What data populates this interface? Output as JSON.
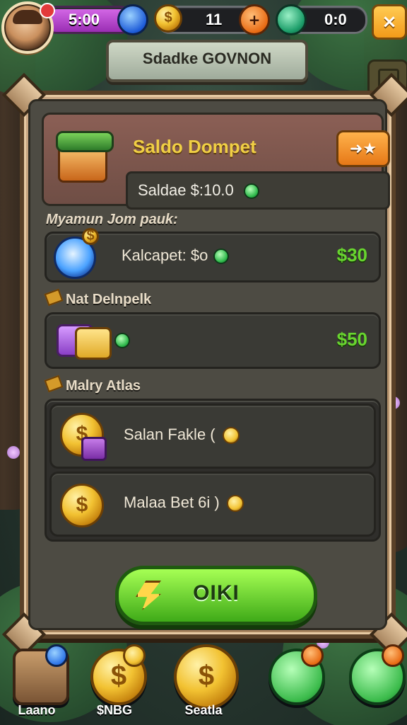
{
  "hud": {
    "resource_purple": "5:00",
    "resource_coins": "11",
    "resource_green": "0:0",
    "close_icon": "close-icon",
    "plus_icon": "plus-icon"
  },
  "title_banner": "Sdadke GOVNON",
  "panel": {
    "header": {
      "title": "Saldo Dompet",
      "balance_text": "Saldae $:10.0",
      "header_button_icon": "arrow-star-icon"
    },
    "section1": {
      "title": "Myamun Jom pauk:",
      "item": {
        "label": "Kalcapet: $o",
        "price": "$30",
        "icon": "candy-icon"
      }
    },
    "section2": {
      "title": "Nat Delnpelk",
      "item": {
        "label": "",
        "price": "$50",
        "icon": "tickets-icon"
      }
    },
    "section3": {
      "title": "Malry Atlas",
      "items": [
        {
          "label": "Salan Fakle (",
          "icon": "coin-gift-icon"
        },
        {
          "label": "Malaa Bet 6i )",
          "icon": "coin-icon"
        }
      ]
    },
    "ok_button": "OIKI"
  },
  "bottom_nav": [
    {
      "label": "Laano",
      "icon": "crate-icon"
    },
    {
      "label": "$NBG",
      "icon": "coin-bag-icon"
    },
    {
      "label": "Seatla",
      "icon": "coin-icon"
    },
    {
      "label": "",
      "icon": "horn-icon"
    },
    {
      "label": "",
      "icon": "star-icon"
    }
  ],
  "colors": {
    "panel_bg": "#4d4b43",
    "panel_frame": "#a8855f",
    "accent_gold": "#f0cf44",
    "price_green": "#68d52f",
    "ok_button": "#3faa18"
  }
}
